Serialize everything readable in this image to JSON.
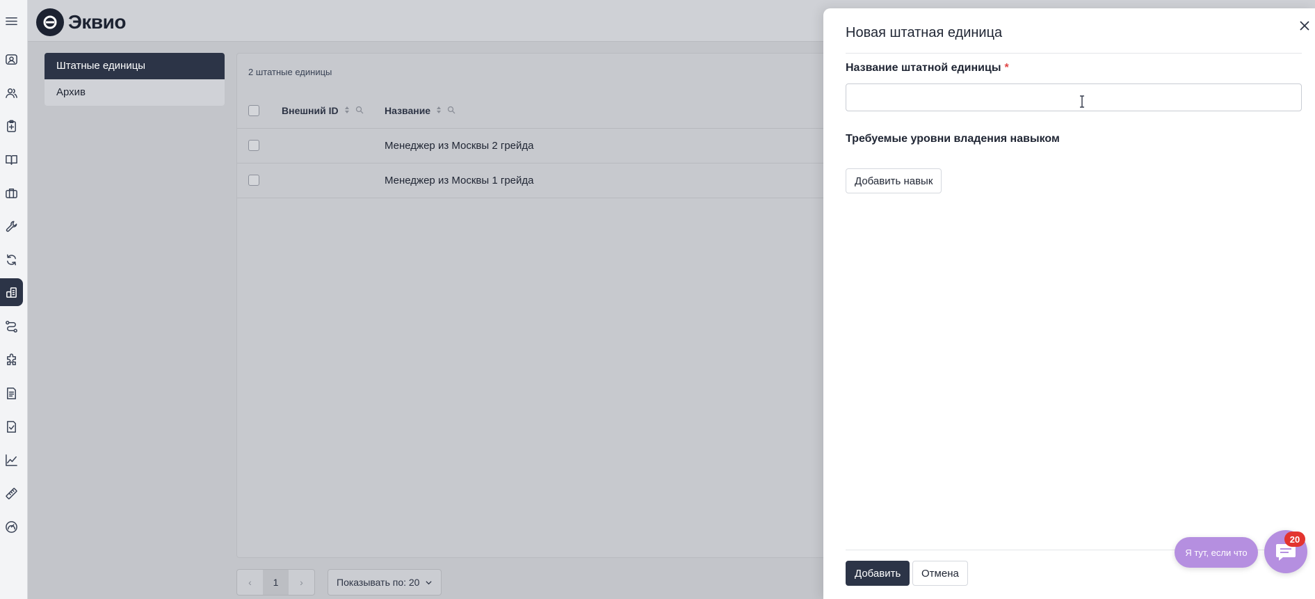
{
  "app": {
    "logo_text": "Эквио"
  },
  "sidebar": {
    "icons": [
      "menu-icon",
      "profile-card-icon",
      "users-icon",
      "clipboard-add-icon",
      "book-icon",
      "briefcase-icon",
      "wrench-icon",
      "refresh-icon",
      "building-icon",
      "route-icon",
      "puzzle-icon",
      "document-list-icon",
      "document-check-icon",
      "chart-line-icon",
      "ruler-icon",
      "gauge-icon"
    ],
    "active": "building-icon"
  },
  "subnav": {
    "items": [
      {
        "label": "Штатные единицы",
        "active": true
      },
      {
        "label": "Архив",
        "active": false
      }
    ]
  },
  "table": {
    "count_label": "2 штатные единицы",
    "columns": {
      "external_id": "Внешний ID",
      "name": "Название"
    },
    "rows": [
      {
        "name": "Менеджер из Москвы 2 грейда"
      },
      {
        "name": "Менеджер из Москвы 1 грейда"
      }
    ]
  },
  "pagination": {
    "prev": "‹",
    "current_page": "1",
    "next": "›",
    "per_page_label": "Показывать по: 20"
  },
  "drawer": {
    "title": "Новая штатная единица",
    "name_label": "Название штатной единицы",
    "required_mark": "*",
    "name_value": "",
    "skills_title": "Требуемые уровни владения навыком",
    "add_skill_label": "Добавить навык",
    "submit_label": "Добавить",
    "cancel_label": "Отмена"
  },
  "chat": {
    "hint": "Я тут, если что",
    "badge": "20"
  },
  "colors": {
    "primary": "#2c3447",
    "chat": "#b58fe0",
    "badge": "#e3342f",
    "required": "#e04646"
  }
}
